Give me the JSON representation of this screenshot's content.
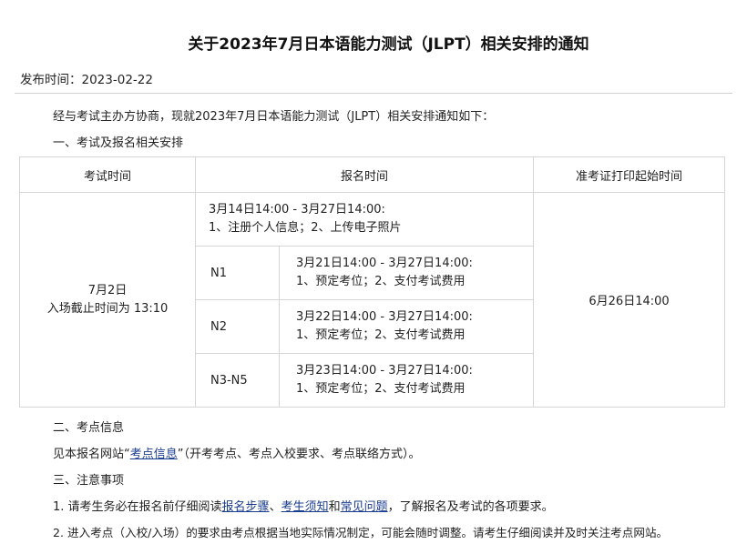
{
  "notice": {
    "title": "关于2023年7月日本语能力测试（JLPT）相关安排的通知",
    "publish_label": "发布时间：",
    "publish_date": "2023-02-22",
    "intro": "经与考试主办方协商，现就2023年7月日本语能力测试（JLPT）相关安排通知如下：",
    "section1_heading": "一、考试及报名相关安排"
  },
  "table": {
    "headers": [
      "考试时间",
      "报名时间",
      "准考证打印起始时间"
    ],
    "exam_date": "7月2日",
    "entry_deadline": "入场截止时间为 13:10",
    "register_all": {
      "period": "3月14日14:00 - 3月27日14:00:",
      "steps": "1、注册个人信息；2、上传电子照片"
    },
    "levels": [
      {
        "level": "N1",
        "period": "3月21日14:00 - 3月27日14:00:",
        "steps": "1、预定考位；2、支付考试费用"
      },
      {
        "level": "N2",
        "period": "3月22日14:00 - 3月27日14:00:",
        "steps": "1、预定考位；2、支付考试费用"
      },
      {
        "level": "N3-N5",
        "period": "3月23日14:00 - 3月27日14:00:",
        "steps": "1、预定考位；2、支付考试费用"
      }
    ],
    "print_start": "6月26日14:00"
  },
  "section2": {
    "heading": "二、考点信息",
    "text_before": "见本报名网站“",
    "link": "考点信息",
    "text_after": "”（开考考点、考点入校要求、考点联络方式）。"
  },
  "section3": {
    "heading": "三、注意事项",
    "item1_before": "1. 请考生务必在报名前仔细阅读",
    "item1_link1": "报名步骤",
    "item1_sep1": "、",
    "item1_link2": "考生须知",
    "item1_sep2": "和",
    "item1_link3": "常见问题",
    "item1_after": "，了解报名及考试的各项要求。",
    "item2": "2. 进入考点（入校/入场）的要求由考点根据当地实际情况制定，可能会随时调整。请考生仔细阅读并及时关注考点网站。"
  },
  "colors": {
    "link": "#1a3c8f",
    "border": "#d6d6d6",
    "text": "#222222"
  }
}
